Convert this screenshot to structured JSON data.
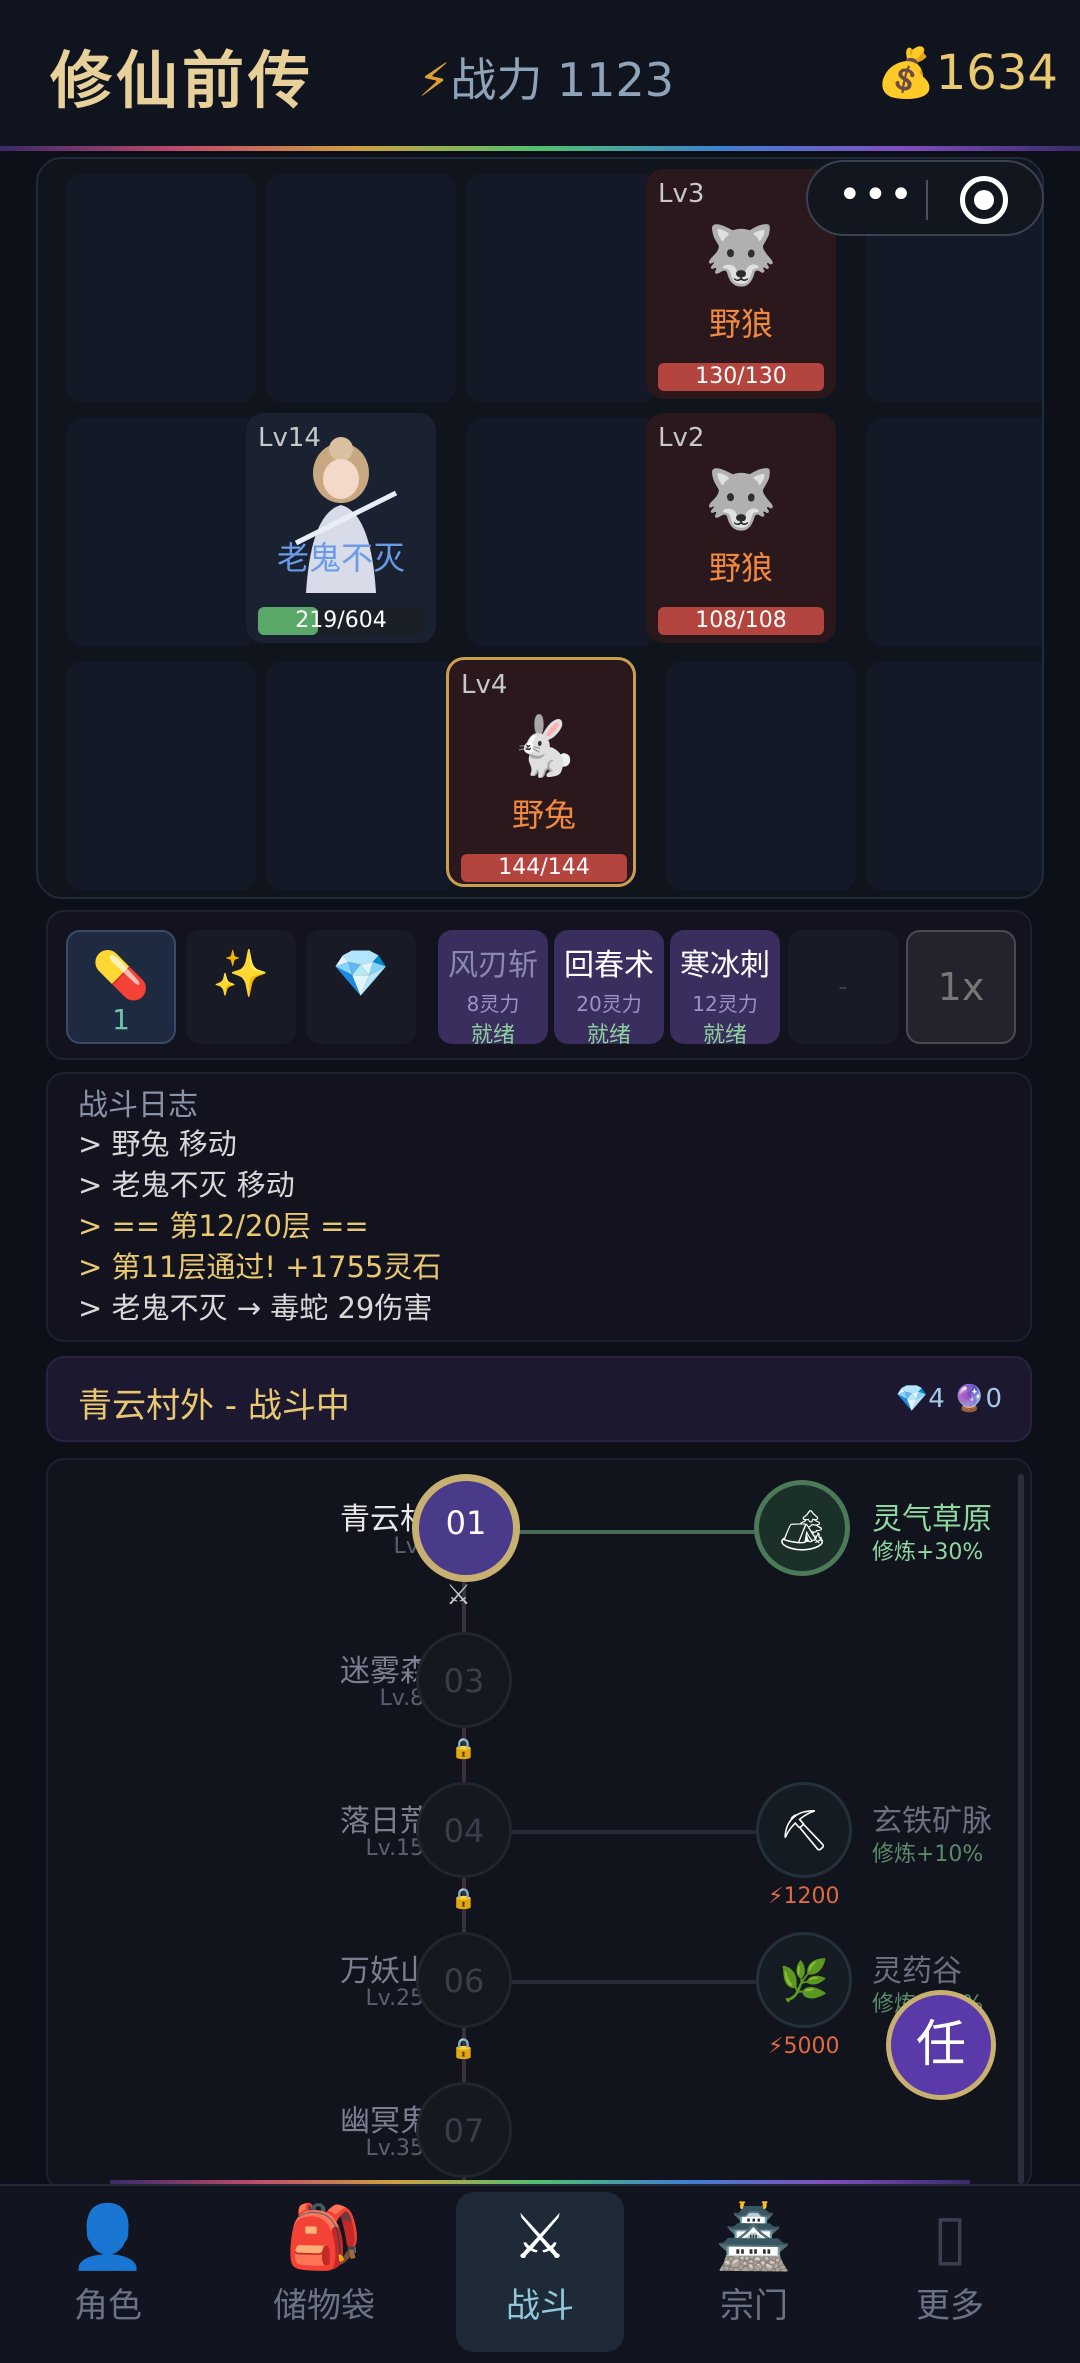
{
  "header": {
    "title": "修仙前传",
    "power_label": "战力",
    "power_value": "1123",
    "coins": "1634"
  },
  "grid": {
    "hero": {
      "level": "Lv14",
      "name": "老鬼不灭",
      "hp": "219/604",
      "hp_ratio": 0.36
    },
    "enemies": [
      {
        "level": "Lv3",
        "name": "野狼",
        "hp": "130/130",
        "icon": "wolf-icon"
      },
      {
        "level": "Lv2",
        "name": "野狼",
        "hp": "108/108",
        "icon": "wolf-icon"
      },
      {
        "level": "Lv4",
        "name": "野兔",
        "hp": "144/144",
        "icon": "rabbit-icon",
        "selected": true
      }
    ]
  },
  "skills": {
    "items": [
      {
        "icon": "pill-icon",
        "count": "1"
      },
      {
        "icon": "sparkle-icon",
        "count": ""
      },
      {
        "icon": "gem-icon",
        "count": ""
      }
    ],
    "list": [
      {
        "name": "风刃斩",
        "cost": "8灵力",
        "status": "就绪"
      },
      {
        "name": "回春术",
        "cost": "20灵力",
        "status": "就绪"
      },
      {
        "name": "寒冰刺",
        "cost": "12灵力",
        "status": "就绪"
      }
    ],
    "empty": "-",
    "speed": "1x"
  },
  "log": {
    "title": "战斗日志",
    "lines": [
      "> 野兔 移动",
      "> 老鬼不灭 移动",
      "> == 第12/20层 ==",
      "> 第11层通过! +1755灵石",
      "> 老鬼不灭 → 毒蛇 29伤害"
    ]
  },
  "stage": {
    "title": "青云村外 - 战斗中",
    "gems": "4",
    "orbs": "0"
  },
  "map": {
    "zones": [
      {
        "num": "01",
        "name": "青云村外",
        "lv": "Lv.1-5"
      },
      {
        "num": "03",
        "name": "迷雾森林",
        "lv": "Lv.8-15"
      },
      {
        "num": "04",
        "name": "落日荒漠",
        "lv": "Lv.15-25"
      },
      {
        "num": "06",
        "name": "万妖山脉",
        "lv": "Lv.25-35"
      },
      {
        "num": "07",
        "name": "幽冥鬼域",
        "lv": "Lv.35-45"
      }
    ],
    "sides": [
      {
        "name": "灵气草原",
        "bonus": "修炼+30%",
        "icon": "camp-icon"
      },
      {
        "name": "玄铁矿脉",
        "bonus": "修炼+10%",
        "cost": "⚡1200",
        "icon": "pickaxe-icon"
      },
      {
        "name": "灵药谷",
        "bonus": "修炼+50%",
        "cost": "⚡5000",
        "icon": "herb-icon"
      }
    ],
    "task": "任"
  },
  "nav": [
    "角色",
    "储物袋",
    "战斗",
    "宗门",
    "更多"
  ]
}
